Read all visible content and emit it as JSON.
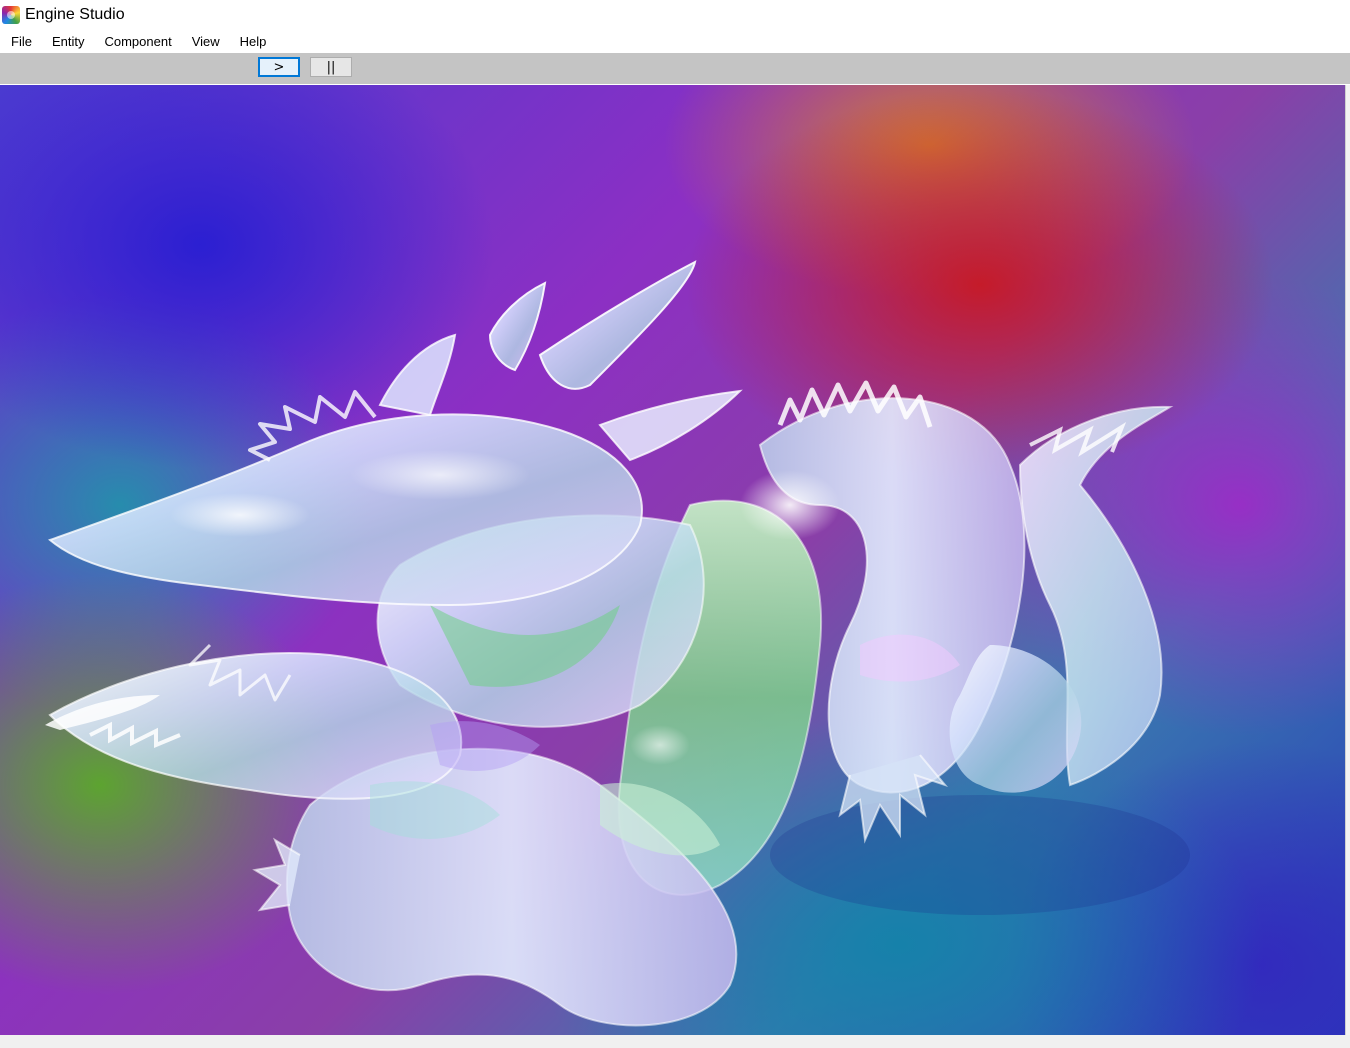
{
  "window": {
    "title": "Engine Studio",
    "app_icon": "engine-studio-logo-icon"
  },
  "menubar": {
    "items": [
      {
        "label": "File"
      },
      {
        "label": "Entity"
      },
      {
        "label": "Component"
      },
      {
        "label": "View"
      },
      {
        "label": "Help"
      }
    ]
  },
  "toolbar": {
    "play_label": ">",
    "play_icon": "play-icon",
    "pause_label": "||",
    "pause_icon": "pause-icon",
    "active_button_color": "#0078d7"
  },
  "viewport": {
    "scene_subject": "glass-dragon-render",
    "background_colors": [
      "#2a1fd0",
      "#8c2fc4",
      "#c8192a",
      "#d78228",
      "#5aaa28",
      "#1482aa",
      "#3228be"
    ]
  }
}
